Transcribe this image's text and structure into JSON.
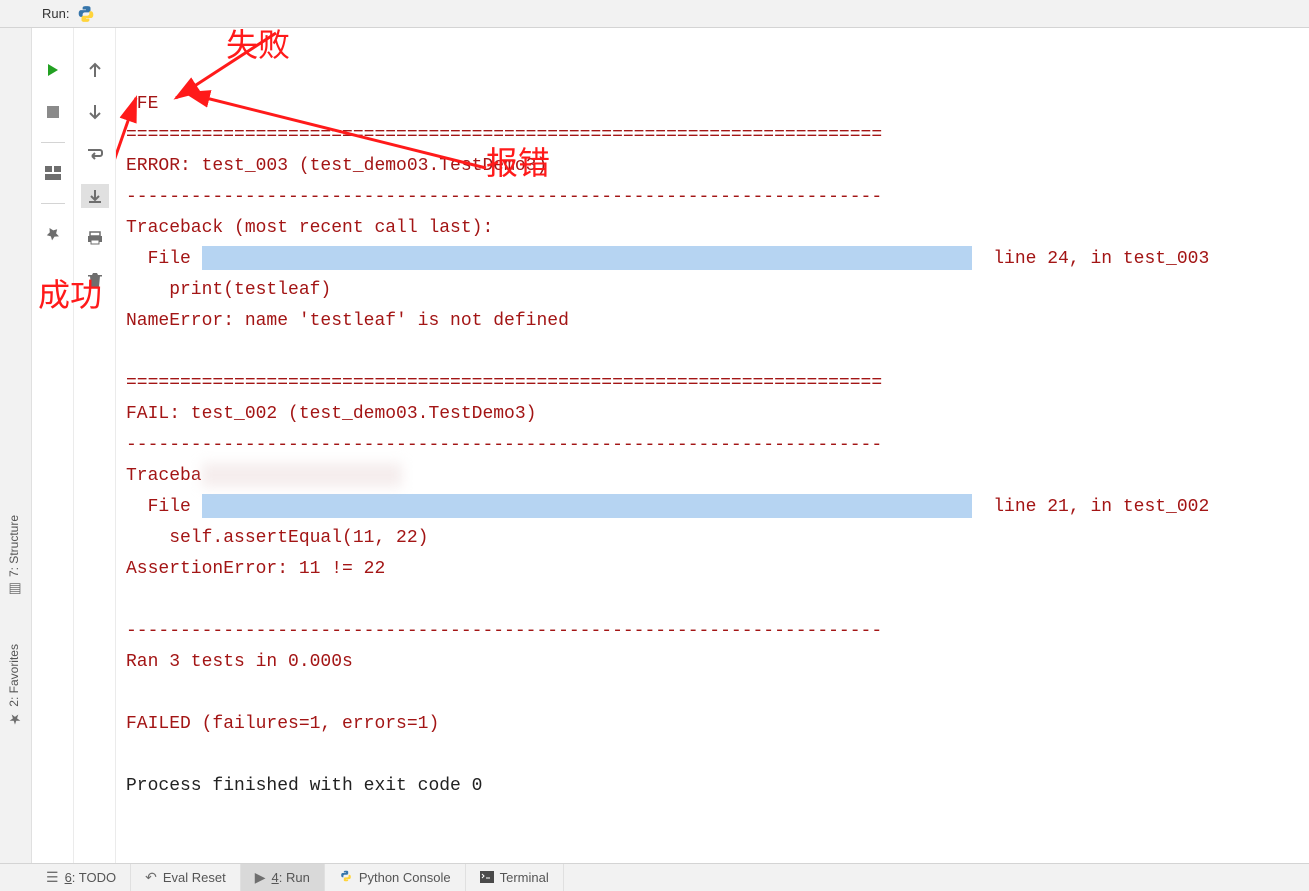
{
  "topbar": {
    "run_label": "Run:"
  },
  "toolbar": {
    "run": "▶",
    "stop": "■",
    "layout": "⇤",
    "pin": "📌"
  },
  "nav": {
    "up": "↑",
    "down": "↓",
    "wrap": "↩",
    "scroll": "⤓",
    "print": "🖶",
    "trash": "🗑"
  },
  "console": {
    "line_fe": ".FE",
    "sep_eq": "======================================================================",
    "err_header": "ERROR: test_003 (test_demo03.TestDemo3)",
    "sep_dash": "----------------------------------------------------------------------",
    "tb_header": "Traceback (most recent call last):",
    "file_prefix": "  File ",
    "line24": "  line 24, in test_003",
    "print_line": "    print(testleaf)",
    "name_error": "NameError: name 'testleaf' is not defined",
    "fail_header": "FAIL: test_002 (test_demo03.TestDemo3)",
    "tb_short": "Traceba",
    "line21": "  line 21, in test_002",
    "assert_line": "    self.assertEqual(11, 22)",
    "assert_error": "AssertionError: 11 != 22",
    "ran_line": "Ran 3 tests in 0.000s",
    "failed_line": "FAILED (failures=1, errors=1)",
    "process_line": "Process finished with exit code 0"
  },
  "annotations": {
    "fail": "失败",
    "error": "报错",
    "success": "成功"
  },
  "sidebar": {
    "structure": {
      "label": "7: Structure",
      "key": "7"
    },
    "favorites": {
      "label": "2: Favorites",
      "key": "2"
    }
  },
  "bottom": {
    "todo": {
      "label": "6: TODO",
      "key": "6"
    },
    "eval": {
      "label": "Eval Reset"
    },
    "run": {
      "label": "4: Run",
      "key": "4"
    },
    "pyconsole": {
      "label": "Python Console"
    },
    "terminal": {
      "label": "Terminal"
    }
  }
}
